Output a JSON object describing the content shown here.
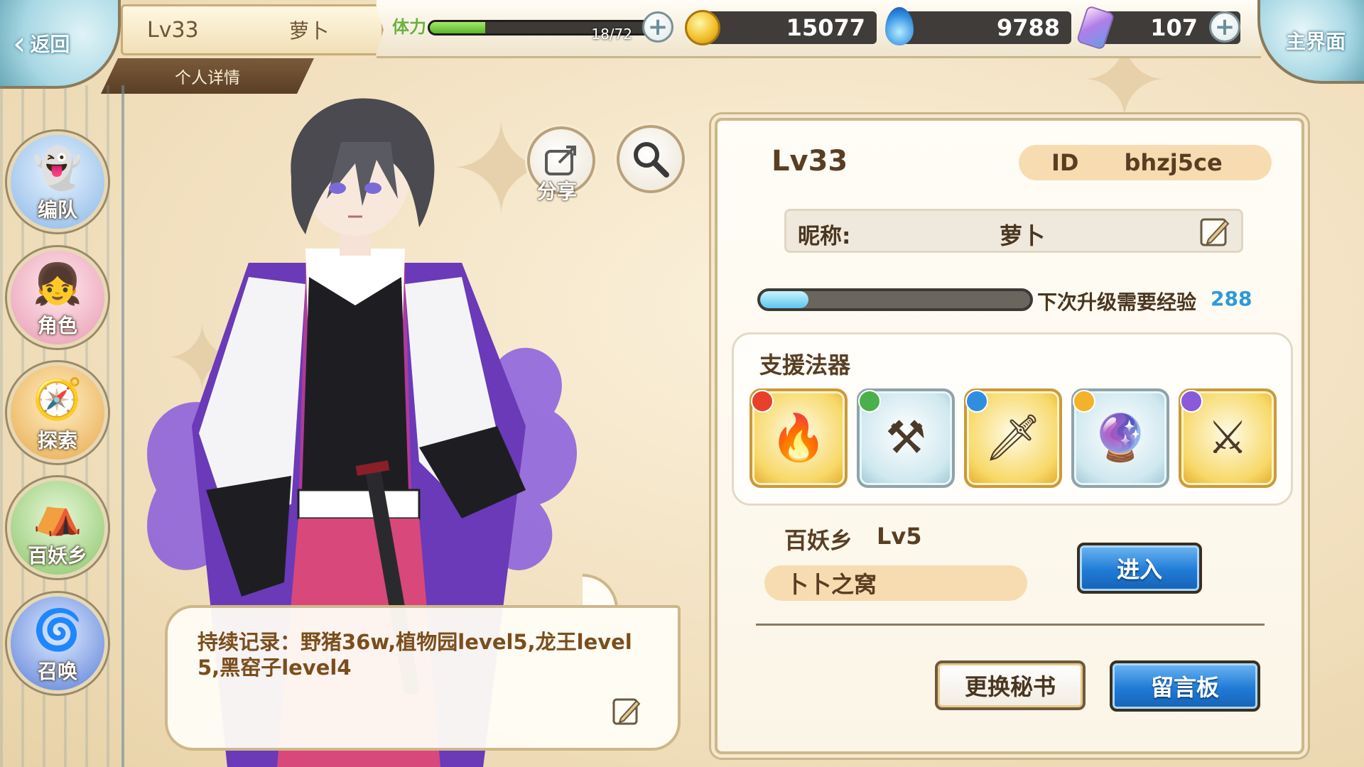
{
  "header": {
    "back_label": "返回",
    "player_level": "Lv33",
    "player_name": "萝卜",
    "profile_tab": "个人详情",
    "home_label": "主界面"
  },
  "resources": {
    "stamina_label": "体力",
    "stamina_current": 18,
    "stamina_max": 72,
    "stamina_text": "18/72",
    "gold": "15077",
    "soul_fire": "9788",
    "crystal": "107"
  },
  "sidebar": {
    "items": [
      {
        "label": "编队",
        "icon": "team-icon"
      },
      {
        "label": "角色",
        "icon": "character-icon"
      },
      {
        "label": "探索",
        "icon": "explore-icon"
      },
      {
        "label": "百妖乡",
        "icon": "village-icon"
      },
      {
        "label": "召唤",
        "icon": "summon-icon"
      }
    ]
  },
  "actions": {
    "share_label": "分享"
  },
  "bubble": {
    "text": "持续记录：野猪36w,植物园level5,龙王level 5,黑窑子level4"
  },
  "profile": {
    "level": "Lv33",
    "id_label": "ID",
    "id_value": "bhzj5ce",
    "nickname_label": "昵称:",
    "nickname": "萝卜",
    "exp_label": "下次升级需要经验",
    "exp_needed": "288",
    "exp_progress": 0.18
  },
  "artifacts": {
    "title": "支援法器",
    "slots": [
      {
        "icon": "flame-charm-icon",
        "frame": "gold",
        "badge_color": "#e8402a"
      },
      {
        "icon": "scythe-icon",
        "frame": "blue",
        "badge_color": "#4ab04a"
      },
      {
        "icon": "sword-icon",
        "frame": "gold",
        "badge_color": "#2f8ee0"
      },
      {
        "icon": "mirror-icon",
        "frame": "blue",
        "badge_color": "#f2b22c"
      },
      {
        "icon": "claw-icon",
        "frame": "gold",
        "badge_color": "#8a5ad8"
      }
    ]
  },
  "village": {
    "title": "百妖乡",
    "level": "Lv5",
    "name": "卜卜之窝",
    "enter_label": "进入"
  },
  "buttons": {
    "secretary_label": "更换秘书",
    "message_board_label": "留言板"
  },
  "colors": {
    "accent_blue": "#1f7bd6",
    "stamina_green": "#5bb52a",
    "exp_blue": "#2d9ad8",
    "pill_tan": "#f7dcb2"
  }
}
